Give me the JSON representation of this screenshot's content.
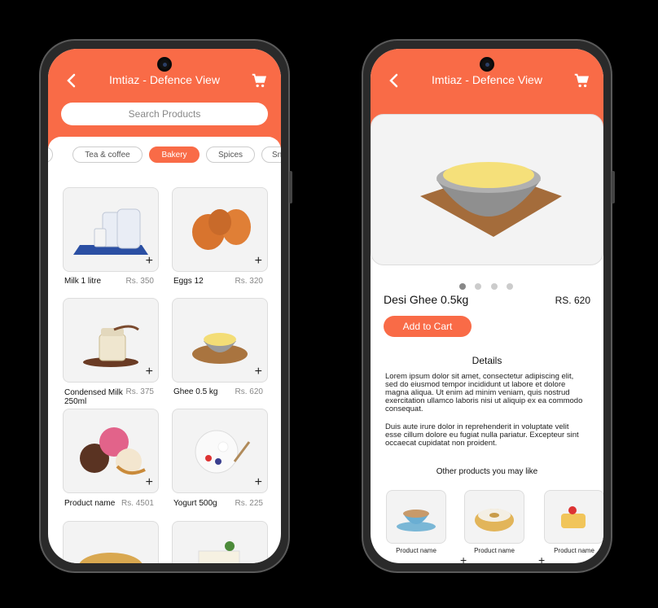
{
  "store_title": "Imtiaz - Defence View",
  "search": {
    "placeholder": "Search Products"
  },
  "categories": [
    {
      "label": "Tea & coffee"
    },
    {
      "label": "Bakery",
      "active": true
    },
    {
      "label": "Spices"
    },
    {
      "label": "Snac"
    }
  ],
  "products": [
    {
      "name": "Milk 1 litre",
      "price": "Rs. 350"
    },
    {
      "name": "Eggs 12",
      "price": "Rs. 320"
    },
    {
      "name": "Condensed Milk 250ml",
      "price": "Rs. 375"
    },
    {
      "name": "Ghee 0.5 kg",
      "price": "Rs. 620"
    },
    {
      "name": "Product name",
      "price": "Rs. 4501"
    },
    {
      "name": "Yogurt 500g",
      "price": "Rs. 225"
    }
  ],
  "detail": {
    "name": "Desi Ghee 0.5kg",
    "price": "RS. 620",
    "add_to_cart": "Add to Cart",
    "details_heading": "Details",
    "paragraph1": "Lorem ipsum dolor sit amet, consectetur adipiscing elit, sed do eiusmod tempor incididunt ut labore et dolore magna aliqua. Ut enim ad minim veniam, quis nostrud exercitation ullamco laboris nisi ut aliquip ex ea commodo consequat.",
    "paragraph2": "Duis aute irure dolor in reprehenderit in voluptate velit esse cillum dolore eu fugiat nulla pariatur. Excepteur sint occaecat cupidatat non proident.",
    "other_heading": "Other products you may like",
    "other_products": [
      "Product name",
      "Product name",
      "Product name"
    ],
    "carousel": {
      "total": 4,
      "active": 1
    }
  },
  "colors": {
    "accent": "#f96b47"
  }
}
